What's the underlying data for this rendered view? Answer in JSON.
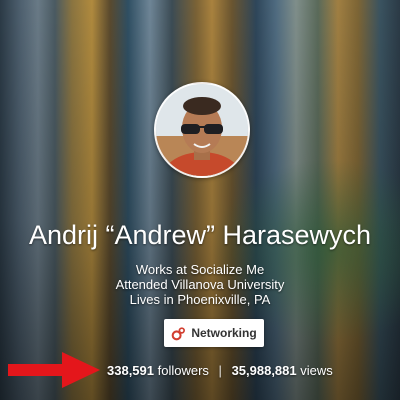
{
  "profile": {
    "name": "Andrij “Andrew” Harasewych",
    "work": "Works at Socialize Me",
    "education": "Attended Villanova University",
    "location": "Lives in Phoenixville, PA"
  },
  "circle_button": {
    "label": "Networking",
    "icon": "circles-icon"
  },
  "stats": {
    "followers_count": "338,591",
    "followers_label": "followers",
    "separator": "|",
    "views_count": "35,988,881",
    "views_label": "views"
  },
  "colors": {
    "arrow": "#e4161b",
    "button_icon": "#d23f31",
    "button_text": "#333333"
  }
}
